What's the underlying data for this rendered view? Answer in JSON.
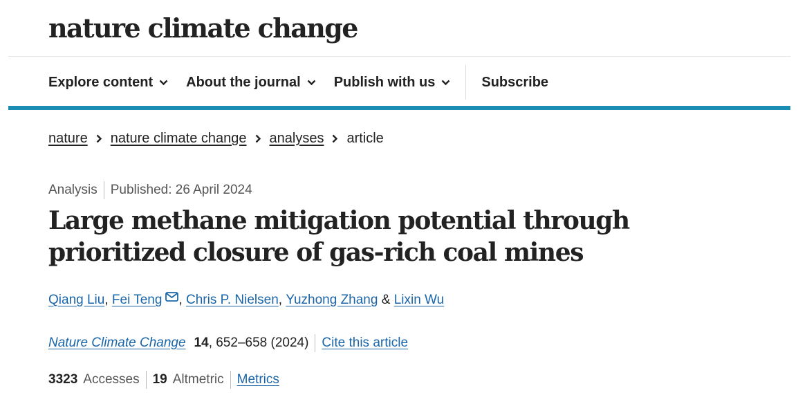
{
  "site": {
    "logo": "nature climate change"
  },
  "nav": {
    "items": [
      {
        "label": "Explore content"
      },
      {
        "label": "About the journal"
      },
      {
        "label": "Publish with us"
      }
    ],
    "subscribe": "Subscribe"
  },
  "breadcrumb": {
    "items": [
      "nature",
      "nature climate change",
      "analyses"
    ],
    "current": "article"
  },
  "article": {
    "type": "Analysis",
    "published": "Published: 26 April 2024",
    "title": "Large methane mitigation potential through prioritized closure of gas-rich coal mines",
    "authors": [
      "Qiang Liu",
      "Fei Teng",
      "Chris P. Nielsen",
      "Yuzhong Zhang",
      "Lixin Wu"
    ],
    "author_sep": ", ",
    "author_last_sep": " & ",
    "journal": "Nature Climate Change",
    "volume": "14",
    "pages_year": ", 652–658 (2024)",
    "cite_label": "Cite this article"
  },
  "metrics": {
    "accesses_count": "3323",
    "accesses_label": "Accesses",
    "altmetric_count": "19",
    "altmetric_label": "Altmetric",
    "metrics_link": "Metrics"
  },
  "colors": {
    "accent": "#1b8db5",
    "link": "#1a65a8",
    "text": "#222222",
    "muted": "#555555"
  }
}
